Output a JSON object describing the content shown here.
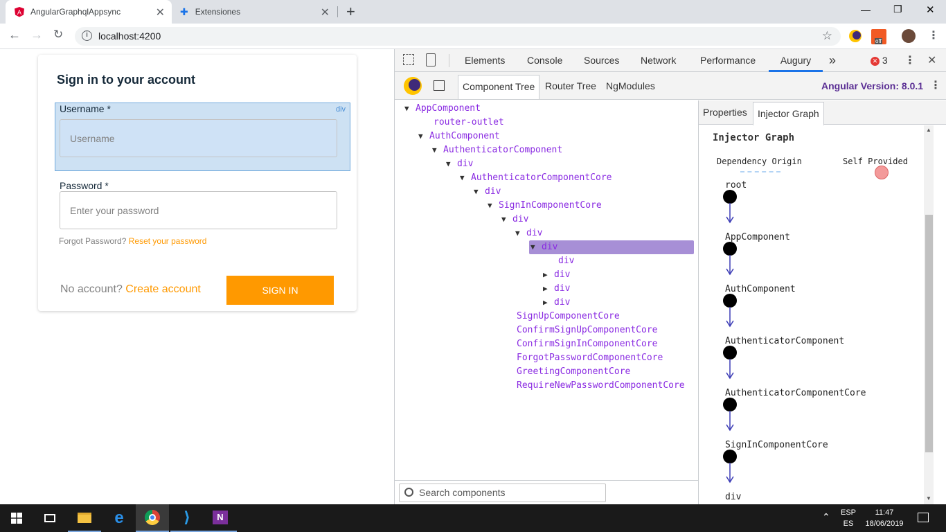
{
  "browser": {
    "tabs": [
      {
        "title": "AngularGraphqlAppsync",
        "active": true
      },
      {
        "title": "Extensiones",
        "active": false
      }
    ],
    "new_tab": "+",
    "url": "localhost:4200",
    "window_controls": {
      "minimize": "—",
      "restore": "❐",
      "close": "✕"
    }
  },
  "signin": {
    "title": "Sign in to your account",
    "username_label": "Username *",
    "username_placeholder": "Username",
    "highlight_tag": "div",
    "password_label": "Password *",
    "password_placeholder": "Enter your password",
    "forgot_text": "Forgot Password?",
    "reset_link": "Reset your password",
    "no_account_text": "No account?",
    "create_link": "Create account",
    "signin_button": "SIGN IN",
    "accent_color": "#ff9900"
  },
  "devtools": {
    "tabs": [
      "Elements",
      "Console",
      "Sources",
      "Network",
      "Performance",
      "Augury"
    ],
    "active_tab": "Augury",
    "more": "»",
    "error_count": "3",
    "augury_tabs": [
      "Component Tree",
      "Router Tree",
      "NgModules"
    ],
    "angular_version": "Angular Version: 8.0.1",
    "tree": [
      {
        "label": "AppComponent",
        "depth": 0,
        "toggle": "▼"
      },
      {
        "label": "router-outlet",
        "depth": 1,
        "toggle": ""
      },
      {
        "label": "AuthComponent",
        "depth": 1,
        "toggle": "▼"
      },
      {
        "label": "AuthenticatorComponent",
        "depth": 2,
        "toggle": "▼"
      },
      {
        "label": "div",
        "depth": 3,
        "toggle": "▼"
      },
      {
        "label": "AuthenticatorComponentCore",
        "depth": 4,
        "toggle": "▼"
      },
      {
        "label": "div",
        "depth": 5,
        "toggle": "▼"
      },
      {
        "label": "SignInComponentCore",
        "depth": 6,
        "toggle": "▼"
      },
      {
        "label": "div",
        "depth": 7,
        "toggle": "▼"
      },
      {
        "label": "div",
        "depth": 8,
        "toggle": "▼"
      },
      {
        "label": "div",
        "depth": 9,
        "toggle": "▼",
        "selected": true
      },
      {
        "label": "div",
        "depth": 10,
        "toggle": ""
      },
      {
        "label": "div",
        "depth": 10,
        "toggle": "▶"
      },
      {
        "label": "div",
        "depth": 10,
        "toggle": "▶"
      },
      {
        "label": "div",
        "depth": 10,
        "toggle": "▶"
      },
      {
        "label": "SignUpComponentCore",
        "depth": 7,
        "toggle": ""
      },
      {
        "label": "ConfirmSignUpComponentCore",
        "depth": 7,
        "toggle": ""
      },
      {
        "label": "ConfirmSignInComponentCore",
        "depth": 7,
        "toggle": ""
      },
      {
        "label": "ForgotPasswordComponentCore",
        "depth": 7,
        "toggle": ""
      },
      {
        "label": "GreetingComponentCore",
        "depth": 7,
        "toggle": ""
      },
      {
        "label": "RequireNewPasswordComponentCore",
        "depth": 7,
        "toggle": ""
      }
    ],
    "search_placeholder": "Search components",
    "right_tabs": [
      "Properties",
      "Injector Graph"
    ],
    "right_active": "Injector Graph",
    "graph_title": "Injector Graph",
    "legend_dependency": "Dependency Origin",
    "legend_self": "Self Provided",
    "graph_nodes": [
      "root",
      "AppComponent",
      "AuthComponent",
      "AuthenticatorComponent",
      "AuthenticatorComponentCore",
      "SignInComponentCore",
      "div"
    ],
    "tree_color": "#8a2be2",
    "selected_color": "#a78fd6"
  },
  "taskbar": {
    "lang_top": "ESP",
    "lang_bottom": "ES",
    "time": "11:47",
    "date": "18/06/2019"
  }
}
